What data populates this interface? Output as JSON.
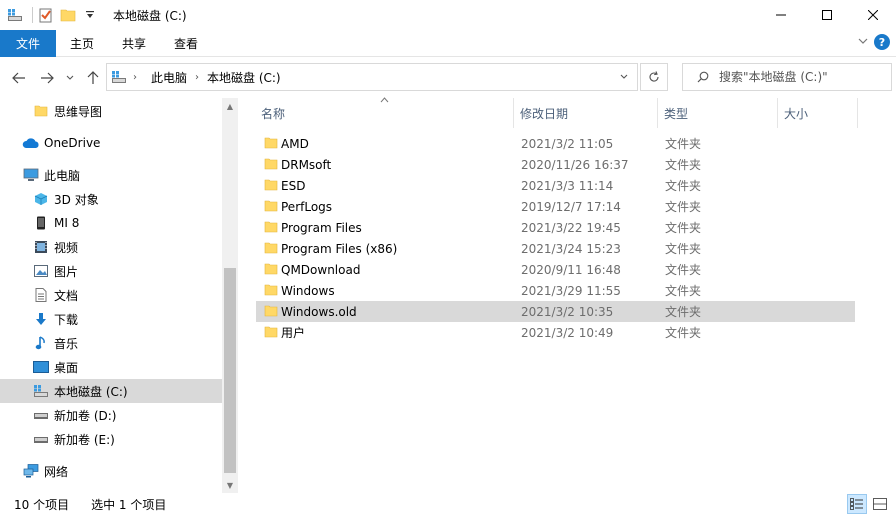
{
  "window": {
    "title": "本地磁盘 (C:)"
  },
  "ribbon": {
    "tabs": [
      "文件",
      "主页",
      "共享",
      "查看"
    ]
  },
  "address": {
    "crumbs": [
      "此电脑",
      "本地磁盘 (C:)"
    ]
  },
  "search": {
    "placeholder": "搜索\"本地磁盘 (C:)\""
  },
  "sidebar": {
    "items": [
      {
        "label": "思维导图",
        "icon": "folder-icon"
      },
      {
        "label": "OneDrive",
        "icon": "cloud-icon"
      },
      {
        "label": "此电脑",
        "icon": "computer-icon"
      },
      {
        "label": "3D 对象",
        "icon": "cube-icon"
      },
      {
        "label": "MI 8",
        "icon": "phone-icon"
      },
      {
        "label": "视频",
        "icon": "video-icon"
      },
      {
        "label": "图片",
        "icon": "picture-icon"
      },
      {
        "label": "文档",
        "icon": "document-icon"
      },
      {
        "label": "下载",
        "icon": "download-icon"
      },
      {
        "label": "音乐",
        "icon": "music-icon"
      },
      {
        "label": "桌面",
        "icon": "desktop-icon"
      },
      {
        "label": "本地磁盘 (C:)",
        "icon": "drive-c-icon"
      },
      {
        "label": "新加卷 (D:)",
        "icon": "drive-icon"
      },
      {
        "label": "新加卷 (E:)",
        "icon": "drive-icon"
      },
      {
        "label": "网络",
        "icon": "network-icon"
      }
    ]
  },
  "columns": {
    "name": "名称",
    "date": "修改日期",
    "type": "类型",
    "size": "大小"
  },
  "files": [
    {
      "name": "AMD",
      "date": "2021/3/2 11:05",
      "type": "文件夹"
    },
    {
      "name": "DRMsoft",
      "date": "2020/11/26 16:37",
      "type": "文件夹"
    },
    {
      "name": "ESD",
      "date": "2021/3/3 11:14",
      "type": "文件夹"
    },
    {
      "name": "PerfLogs",
      "date": "2019/12/7 17:14",
      "type": "文件夹"
    },
    {
      "name": "Program Files",
      "date": "2021/3/22 19:45",
      "type": "文件夹"
    },
    {
      "name": "Program Files (x86)",
      "date": "2021/3/24 15:23",
      "type": "文件夹"
    },
    {
      "name": "QMDownload",
      "date": "2020/9/11 16:48",
      "type": "文件夹"
    },
    {
      "name": "Windows",
      "date": "2021/3/29 11:55",
      "type": "文件夹"
    },
    {
      "name": "Windows.old",
      "date": "2021/3/2 10:35",
      "type": "文件夹"
    },
    {
      "name": "用户",
      "date": "2021/3/2 10:49",
      "type": "文件夹"
    }
  ],
  "status": {
    "count": "10 个项目",
    "selected": "选中 1 个项目"
  },
  "colors": {
    "accent": "#1979ca",
    "folder": "#ffd866",
    "selection": "#d9d9d9"
  }
}
